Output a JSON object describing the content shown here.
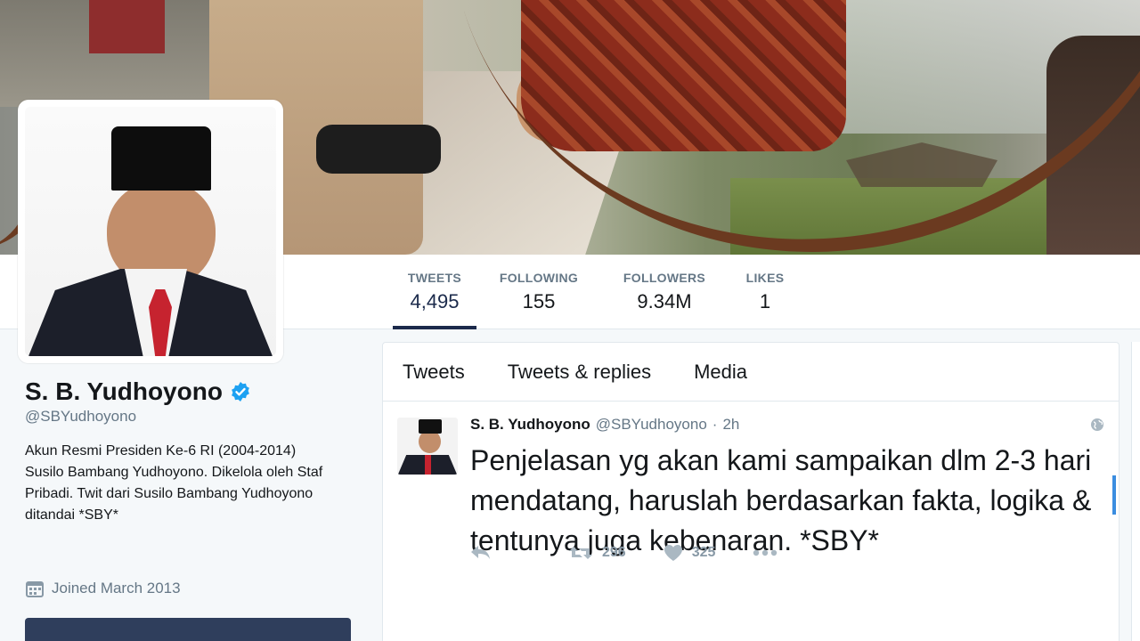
{
  "profile": {
    "name": "S. B. Yudhoyono",
    "handle": "@SBYudhoyono",
    "bio": "Akun Resmi Presiden Ke-6 RI (2004-2014) Susilo Bambang Yudhoyono. Dikelola oleh Staf Pribadi. Twit dari Susilo Bambang Yudhoyono ditandai *SBY*",
    "joined": "Joined March 2013",
    "verified_icon": "verified-badge-icon",
    "accent": "#1da1f2"
  },
  "stats": [
    {
      "label": "TWEETS",
      "value": "4,495"
    },
    {
      "label": "FOLLOWING",
      "value": "155"
    },
    {
      "label": "FOLLOWERS",
      "value": "9.34M"
    },
    {
      "label": "LIKES",
      "value": "1"
    }
  ],
  "tabs": [
    "Tweets",
    "Tweets & replies",
    "Media"
  ],
  "tweet": {
    "name": "S. B. Yudhoyono",
    "handle": "@SBYudhoyono",
    "dot": "·",
    "time": "2h",
    "text": "Penjelasan yg akan kami sampaikan dlm 2-3 hari mendatang, haruslah berdasarkan fakta, logika & tentunya juga kebenaran. *SBY*",
    "retweets": "296",
    "likes": "325"
  }
}
